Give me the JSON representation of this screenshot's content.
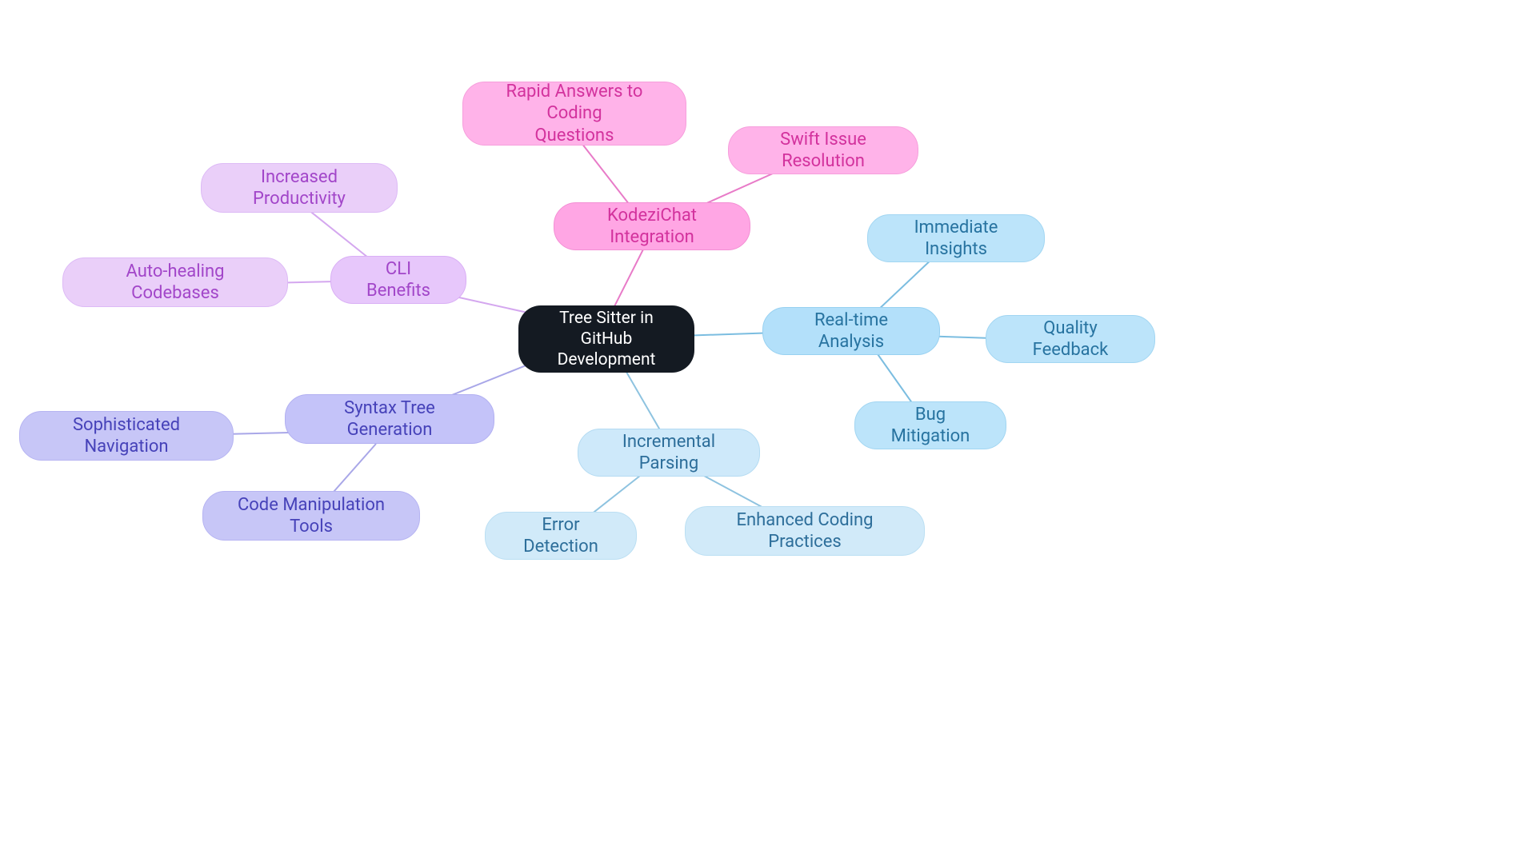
{
  "root": {
    "label": "Tree Sitter in GitHub\nDevelopment"
  },
  "branches": {
    "kodezichat": {
      "label": "KodeziChat Integration",
      "children": [
        "Rapid Answers to Coding\nQuestions",
        "Swift Issue Resolution"
      ]
    },
    "cli": {
      "label": "CLI Benefits",
      "children": [
        "Increased Productivity",
        "Auto-healing Codebases"
      ]
    },
    "syntax": {
      "label": "Syntax Tree Generation",
      "children": [
        "Sophisticated Navigation",
        "Code Manipulation Tools"
      ]
    },
    "incremental": {
      "label": "Incremental Parsing",
      "children": [
        "Error Detection",
        "Enhanced Coding Practices"
      ]
    },
    "realtime": {
      "label": "Real-time Analysis",
      "children": [
        "Immediate Insights",
        "Quality Feedback",
        "Bug Mitigation"
      ]
    }
  },
  "chart_data": {
    "type": "mindmap",
    "root": "Tree Sitter in GitHub Development",
    "branches": [
      {
        "name": "KodeziChat Integration",
        "color": "#ffa6e4",
        "children": [
          "Rapid Answers to Coding Questions",
          "Swift Issue Resolution"
        ]
      },
      {
        "name": "CLI Benefits",
        "color": "#e7c7fb",
        "children": [
          "Increased Productivity",
          "Auto-healing Codebases"
        ]
      },
      {
        "name": "Syntax Tree Generation",
        "color": "#c4c3f9",
        "children": [
          "Sophisticated Navigation",
          "Code Manipulation Tools"
        ]
      },
      {
        "name": "Incremental Parsing",
        "color": "#cee9fa",
        "children": [
          "Error Detection",
          "Enhanced Coding Practices"
        ]
      },
      {
        "name": "Real-time Analysis",
        "color": "#b3e0fa",
        "children": [
          "Immediate Insights",
          "Quality Feedback",
          "Bug Mitigation"
        ]
      }
    ]
  }
}
